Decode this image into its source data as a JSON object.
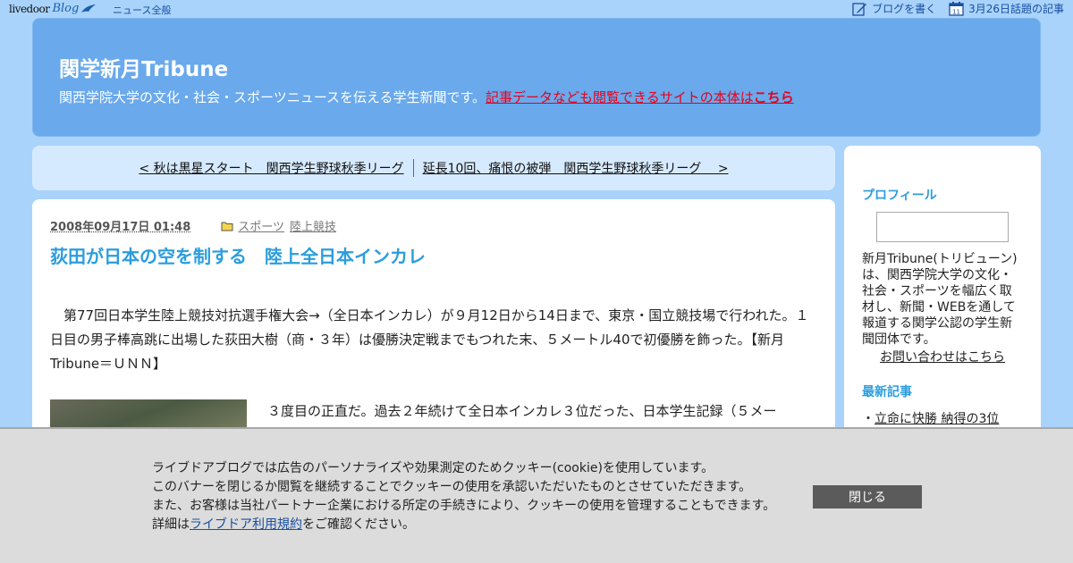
{
  "topbar": {
    "logo_livedoor": "livedoor",
    "logo_blog": "Blog",
    "news_link": "ニュース全般",
    "write_blog": "ブログを書く",
    "topic_date": "3月26日話題の記事",
    "calendar_day": "11"
  },
  "header": {
    "title": "関学新月Tribune",
    "description": "関西学院大学の文化・社会・スポーツニュースを伝える学生新聞です。",
    "link_text": "記事データなども閲覧できるサイトの本体は",
    "link_bold": "こちら"
  },
  "pager": {
    "prev": "< 秋は黒星スタート　関西学生野球秋季リーグ",
    "next": "延長10回、痛恨の被弾　関西学生野球秋季リーグ　 >"
  },
  "article": {
    "date": "2008年09月17日 01:48",
    "categories": [
      "スポーツ",
      "陸上競技"
    ],
    "title": "荻田が日本の空を制する　陸上全日本インカレ",
    "paragraph1": "　第77回日本学生陸上競技対抗選手権大会→（全日本インカレ）が９月12日から14日まで、東京・国立競技場で行われた。１日目の男子棒高跳に出場した荻田大樹（商・３年）は優勝決定戦までもつれた末、５メートル40で初優勝を飾った。【新月Tribune＝ＵＮＮ】",
    "paragraph2": "３度目の正直だ。過去２年続けて全日本インカレ３位だった、日本学生記録（５メー"
  },
  "sidebar": {
    "profile_heading": "プロフィール",
    "profile_text": "新月Tribune(トリビューン)は、関西学院大学の文化・社会・スポーツを幅広く取材し、新聞・WEBを通して報道する関学公認の学生新聞団体です。",
    "contact_link": "お問い合わせはこちら",
    "recent_heading": "最新記事",
    "recent_items": [
      "立命に快勝 納得の3位"
    ]
  },
  "cookie": {
    "line1": "ライブドアブログでは広告のパーソナライズや効果測定のためクッキー(cookie)を使用しています。",
    "line2": "このバナーを閉じるか閲覧を継続することでクッキーの使用を承認いただいたものとさせていただきます。",
    "line3": "また、お客様は当社パートナー企業における所定の手続きにより、クッキーの使用を管理することもできます。",
    "line4_prefix": "詳細は",
    "line4_link": "ライブドア利用規約",
    "line4_suffix": "をご確認ください。",
    "close_button": "閉じる"
  },
  "colors": {
    "background": "#a9d3fb",
    "header_bg": "#69a9ec",
    "accent_title": "#2a9ddd",
    "header_link": "#e8001c"
  }
}
